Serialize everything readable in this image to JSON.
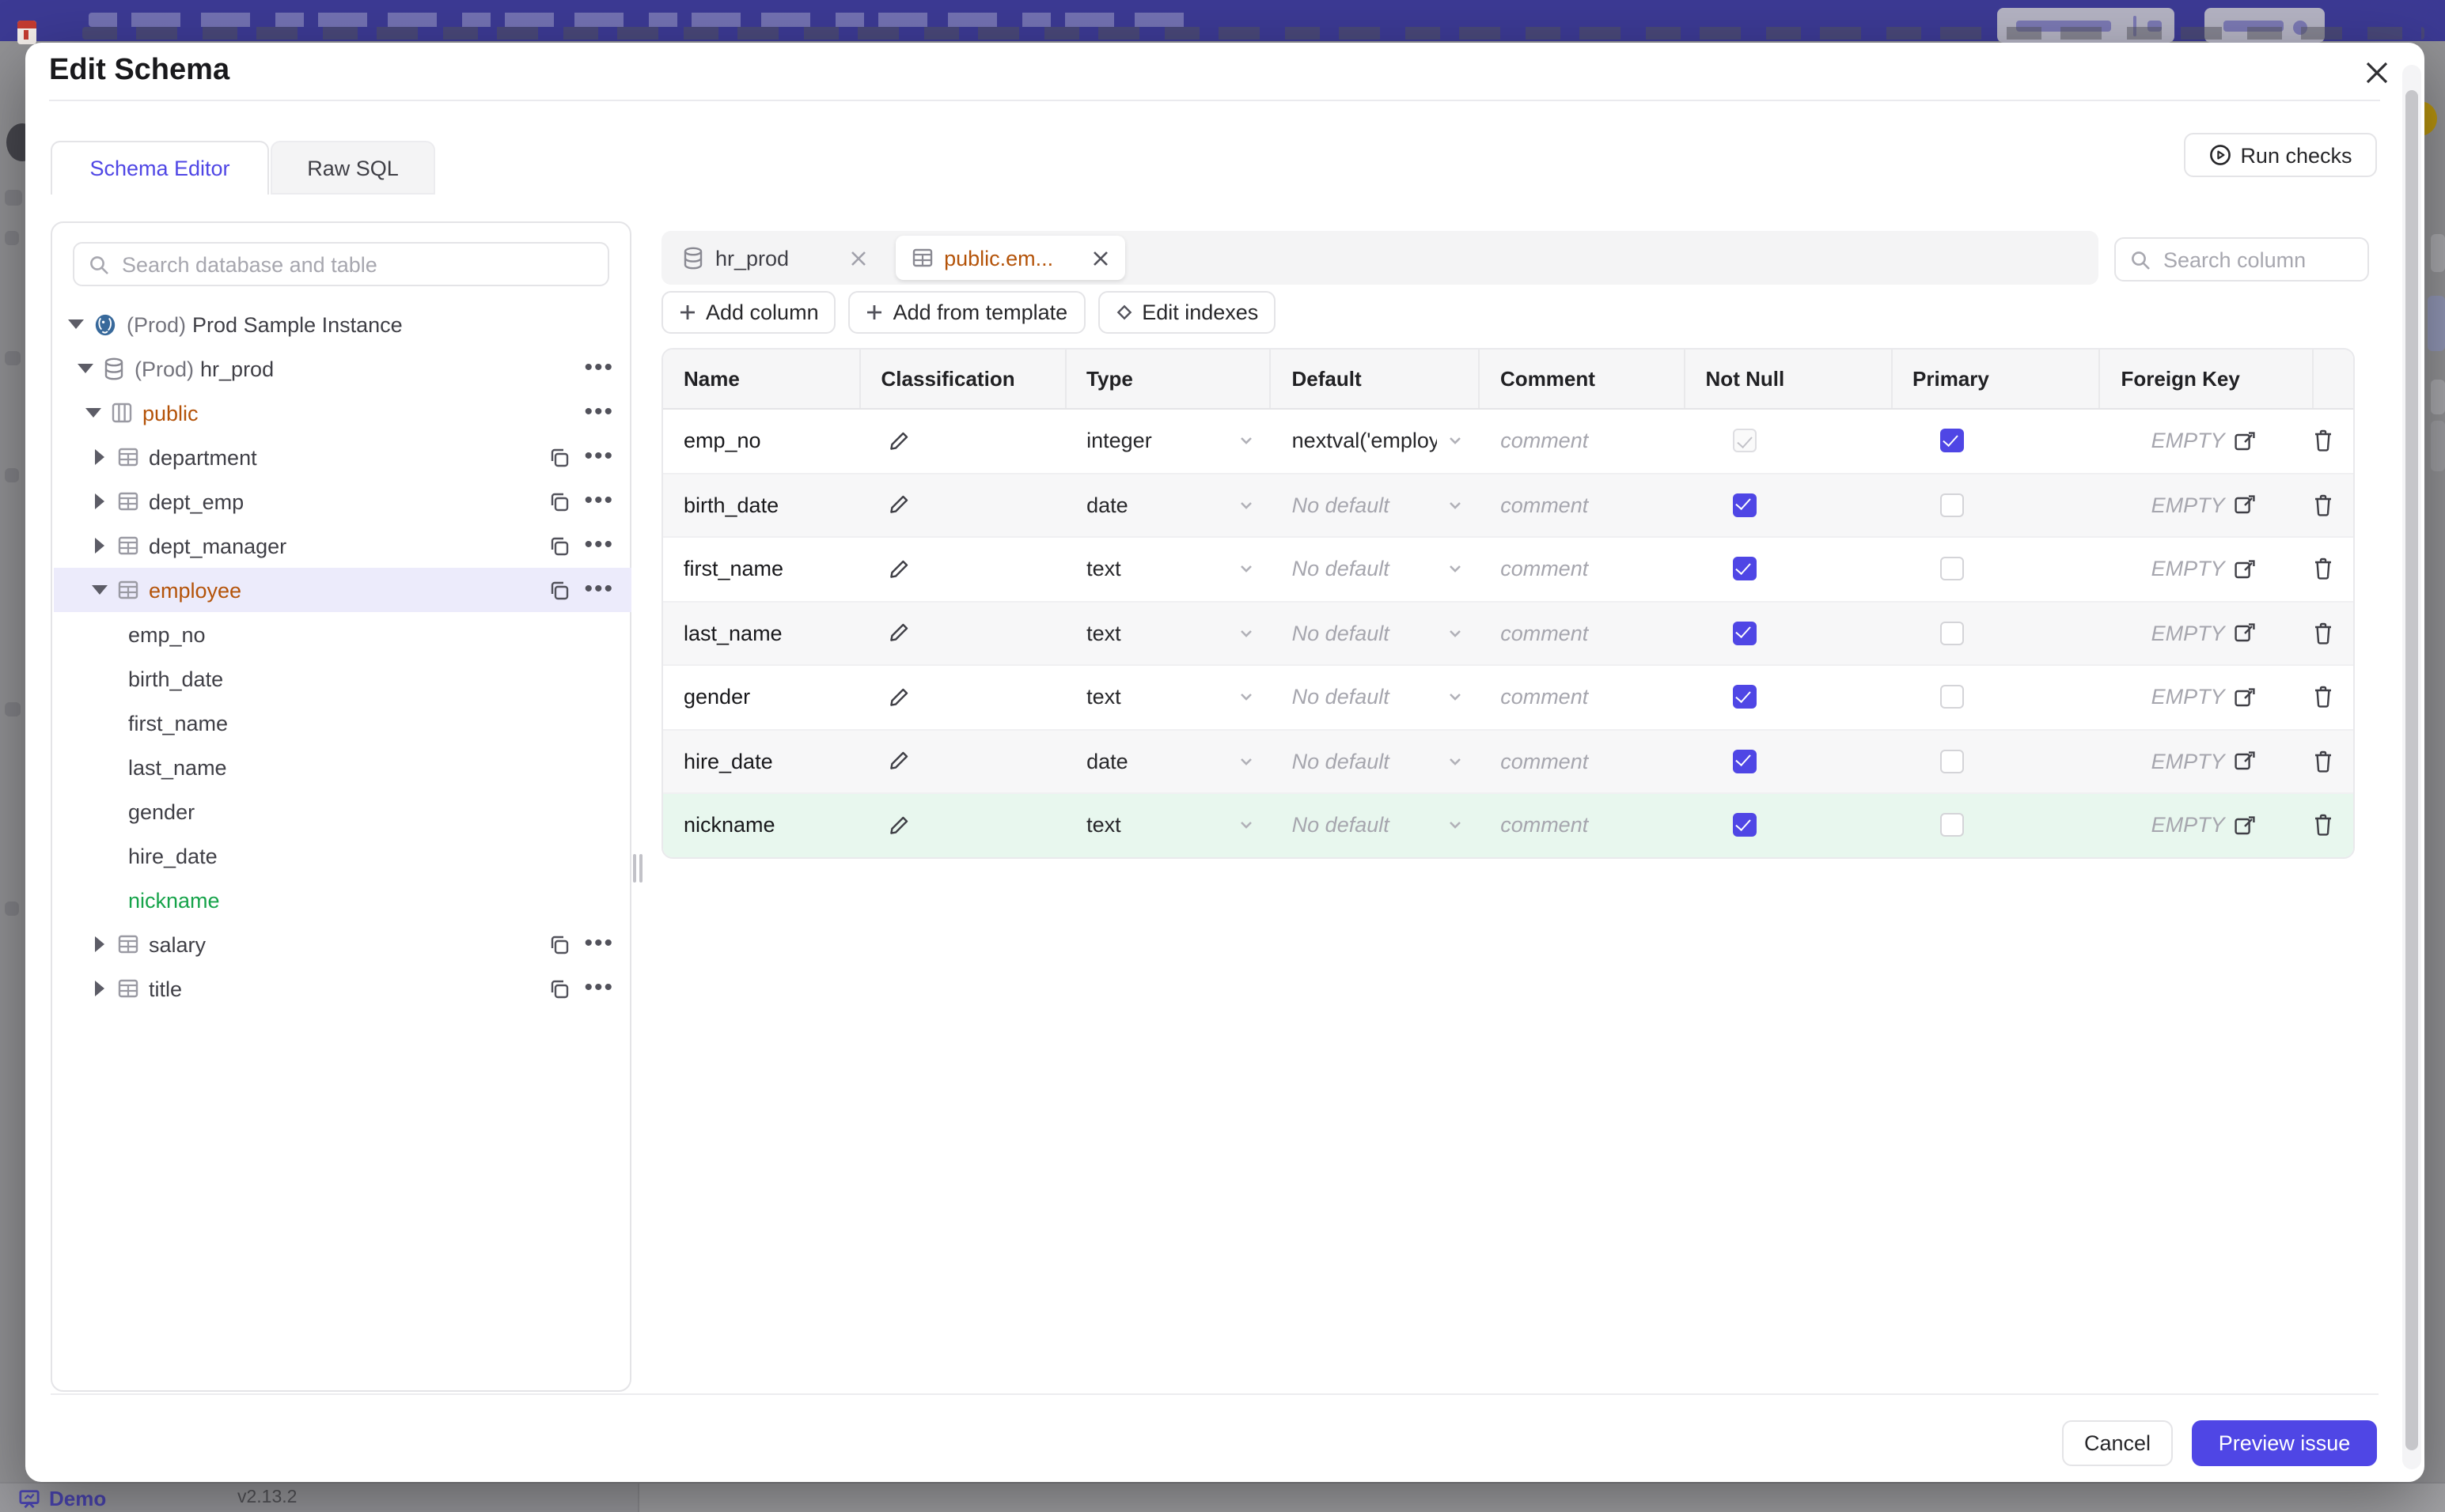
{
  "colors": {
    "accent": "#4f46e5",
    "amber": "#b45309",
    "green": "#16a34a",
    "topbar": "#3c3a94",
    "highlight_row": "#e8f7ee",
    "selected_row": "#ecebfb"
  },
  "modal": {
    "title": "Edit Schema",
    "tabs": [
      {
        "label": "Schema Editor",
        "active": true
      },
      {
        "label": "Raw SQL",
        "active": false
      }
    ],
    "run_checks_label": "Run checks",
    "cancel_label": "Cancel",
    "submit_label": "Preview issue"
  },
  "sidebar": {
    "search_placeholder": "Search database and table",
    "tree": {
      "rows": [
        {
          "prefix": "(Prod)",
          "label": "Prod Sample Instance",
          "type": "instance",
          "expanded": true
        },
        {
          "prefix": "(Prod)",
          "label": "hr_prod",
          "type": "database",
          "expanded": true,
          "menu": true
        },
        {
          "label": "public",
          "type": "schema",
          "expanded": true,
          "menu": true,
          "color": "amber"
        },
        {
          "label": "department",
          "type": "table",
          "copy": true,
          "menu": true
        },
        {
          "label": "dept_emp",
          "type": "table",
          "copy": true,
          "menu": true
        },
        {
          "label": "dept_manager",
          "type": "table",
          "copy": true,
          "menu": true
        },
        {
          "label": "employee",
          "type": "table",
          "expanded": true,
          "selected": true,
          "color": "amber",
          "copy": true,
          "menu": true
        },
        {
          "label": "emp_no",
          "type": "column"
        },
        {
          "label": "birth_date",
          "type": "column"
        },
        {
          "label": "first_name",
          "type": "column"
        },
        {
          "label": "last_name",
          "type": "column"
        },
        {
          "label": "gender",
          "type": "column"
        },
        {
          "label": "hire_date",
          "type": "column"
        },
        {
          "label": "nickname",
          "type": "column",
          "color": "green"
        },
        {
          "label": "salary",
          "type": "table",
          "copy": true,
          "menu": true
        },
        {
          "label": "title",
          "type": "table",
          "copy": true,
          "menu": true
        }
      ]
    }
  },
  "editor": {
    "chips": [
      {
        "label": "hr_prod",
        "icon": "database-icon",
        "active": false
      },
      {
        "label": "public.em...",
        "icon": "table-icon",
        "active": true
      }
    ],
    "toolbar": {
      "add_column": "Add column",
      "add_from_template": "Add from template",
      "edit_indexes": "Edit indexes"
    },
    "search_placeholder": "Search column",
    "table": {
      "headers": [
        "Name",
        "Classification",
        "Type",
        "Default",
        "Comment",
        "Not Null",
        "Primary",
        "Foreign Key"
      ],
      "rows": [
        {
          "name": "emp_no",
          "type": "integer",
          "default": "nextval('employ",
          "default_is_placeholder": false,
          "comment_placeholder": "comment",
          "not_null": "checked-disabled",
          "primary": "checked",
          "foreign_key": "EMPTY",
          "highlight": false
        },
        {
          "name": "birth_date",
          "type": "date",
          "default": "No default",
          "default_is_placeholder": true,
          "comment_placeholder": "comment",
          "not_null": "checked",
          "primary": "unchecked",
          "foreign_key": "EMPTY",
          "highlight": false
        },
        {
          "name": "first_name",
          "type": "text",
          "default": "No default",
          "default_is_placeholder": true,
          "comment_placeholder": "comment",
          "not_null": "checked",
          "primary": "unchecked",
          "foreign_key": "EMPTY",
          "highlight": false
        },
        {
          "name": "last_name",
          "type": "text",
          "default": "No default",
          "default_is_placeholder": true,
          "comment_placeholder": "comment",
          "not_null": "checked",
          "primary": "unchecked",
          "foreign_key": "EMPTY",
          "highlight": false
        },
        {
          "name": "gender",
          "type": "text",
          "default": "No default",
          "default_is_placeholder": true,
          "comment_placeholder": "comment",
          "not_null": "checked",
          "primary": "unchecked",
          "foreign_key": "EMPTY",
          "highlight": false
        },
        {
          "name": "hire_date",
          "type": "date",
          "default": "No default",
          "default_is_placeholder": true,
          "comment_placeholder": "comment",
          "not_null": "checked",
          "primary": "unchecked",
          "foreign_key": "EMPTY",
          "highlight": false
        },
        {
          "name": "nickname",
          "type": "text",
          "default": "No default",
          "default_is_placeholder": true,
          "comment_placeholder": "comment",
          "not_null": "checked",
          "primary": "unchecked",
          "foreign_key": "EMPTY",
          "highlight": true
        }
      ]
    }
  },
  "background": {
    "demo_label": "Demo",
    "version": "v2.13.2"
  }
}
